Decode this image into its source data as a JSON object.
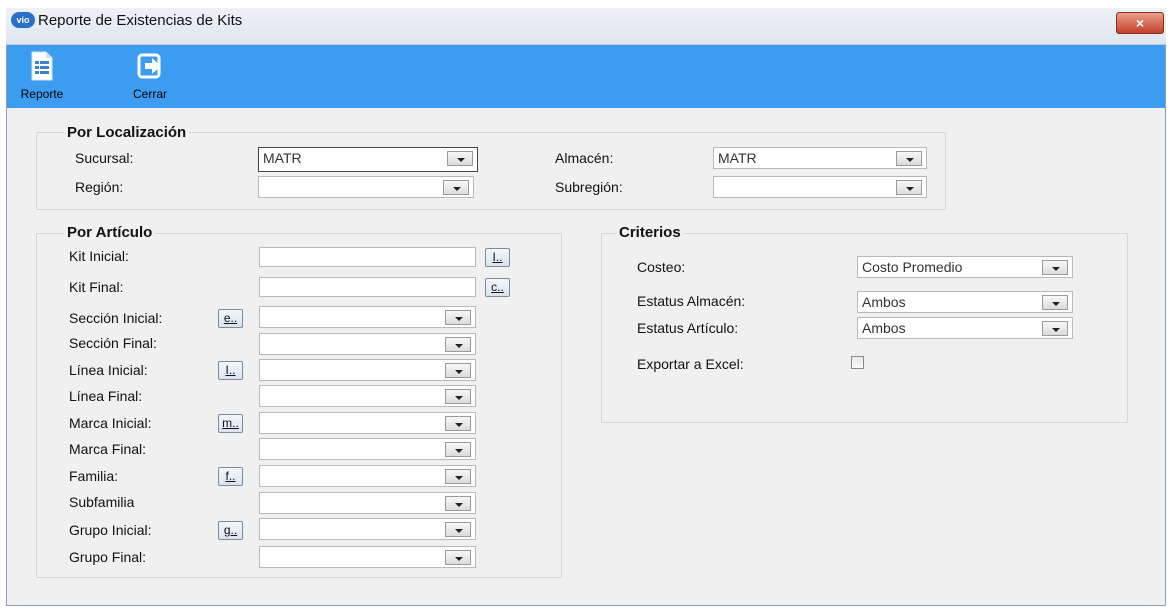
{
  "window": {
    "title": "Reporte de Existencias de Kits",
    "close_symbol": "×",
    "app_icon_text": "vio"
  },
  "toolbar": {
    "reporte_label": "Reporte",
    "cerrar_label": "Cerrar"
  },
  "localizacion": {
    "title": "Por Localización",
    "sucursal_label": "Sucursal:",
    "sucursal_value": "MATR",
    "region_label": "Región:",
    "region_value": "",
    "almacen_label": "Almacén:",
    "almacen_value": "MATR",
    "subregion_label": "Subregión:",
    "subregion_value": ""
  },
  "articulo": {
    "title": "Por Artículo",
    "kit_inicial_label": "Kit Inicial:",
    "kit_inicial_button": "I..",
    "kit_final_label": "Kit Final:",
    "kit_final_button": "c..",
    "seccion_inicial_label": "Sección Inicial:",
    "seccion_button": "e..",
    "seccion_final_label": "Sección Final:",
    "linea_inicial_label": "Línea Inicial:",
    "linea_button": "I..",
    "linea_final_label": "Línea Final:",
    "marca_inicial_label": "Marca Inicial:",
    "marca_button": "m..",
    "marca_final_label": "Marca Final:",
    "familia_label": "Familia:",
    "familia_button": "f..",
    "subfamilia_label": "Subfamilia",
    "grupo_inicial_label": "Grupo Inicial:",
    "grupo_button": "g..",
    "grupo_final_label": "Grupo Final:"
  },
  "criterios": {
    "title": "Criterios",
    "costeo_label": "Costeo:",
    "costeo_value": "Costo Promedio",
    "estatus_almacen_label": "Estatus Almacén:",
    "estatus_almacen_value": "Ambos",
    "estatus_articulo_label": "Estatus Artículo:",
    "estatus_articulo_value": "Ambos",
    "exportar_label": "Exportar a Excel:",
    "exportar_checked": false
  },
  "colors": {
    "toolbar": "#3c9cf0",
    "close": "#c2412a"
  },
  "icons": {
    "reporte": "report-document-icon",
    "cerrar": "exit-arrow-icon"
  }
}
